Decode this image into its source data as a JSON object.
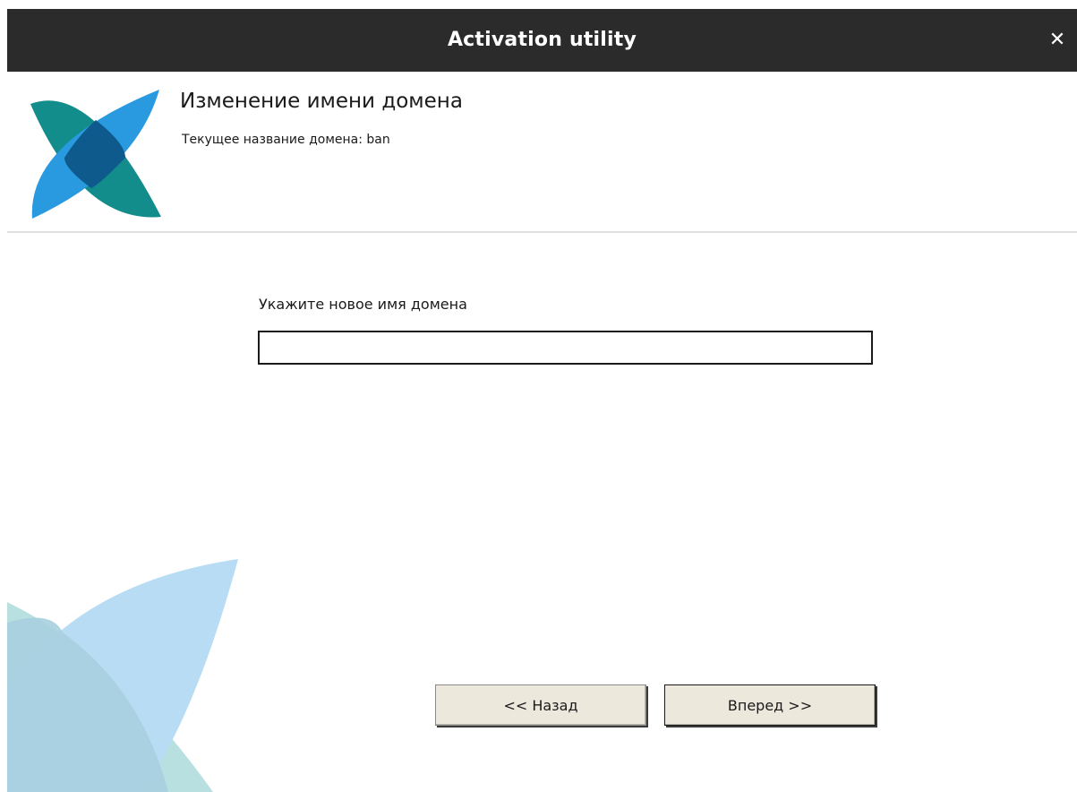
{
  "window": {
    "title": "Activation utility",
    "close_glyph": "✕"
  },
  "header": {
    "title": "Изменение имени домена",
    "subtitle": "Текущее название домена: ban"
  },
  "form": {
    "label": "Укажите новое имя домена",
    "value": "",
    "placeholder": ""
  },
  "buttons": {
    "back_label": "<< Назад",
    "next_label": "Вперед >>"
  },
  "colors": {
    "titlebar": "#2b2b2b",
    "logo_teal": "#1a8f8f",
    "logo_blue": "#2a9ae0",
    "logo_dark": "#0e5c8f",
    "button_bg": "#ece9dc"
  }
}
